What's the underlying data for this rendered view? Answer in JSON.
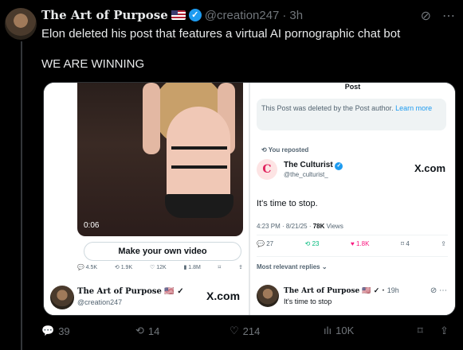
{
  "post": {
    "author_name": "The Art of Purpose",
    "handle": "@creation247",
    "time": "3h",
    "text_line1": "Elon deleted his post that features a virtual AI pornographic chat bot",
    "text_line2": "WE ARE WINNING"
  },
  "media": {
    "video_time": "0:06",
    "make_video_label": "Make your own video",
    "mini_stats": {
      "replies": "4.5K",
      "reposts": "1.9K",
      "likes": "12K",
      "views": "1.8M"
    },
    "mini_author_name": "The Art of Purpose",
    "mini_author_handle": "@creation247",
    "xcom_left": "X.com",
    "right": {
      "header": "Post",
      "deleted_notice": "This Post was deleted by the Post author.",
      "learn_more": "Learn more",
      "reposted": "You reposted",
      "rp_author_name": "The Culturist",
      "rp_author_handle": "@the_culturist_",
      "xcom_right": "X.com",
      "rp_text": "It's time to stop.",
      "rp_time": "4:23 PM · 8/21/25 ·",
      "rp_views": "78K",
      "rp_views_label": "Views",
      "rp_stats": {
        "replies": "27",
        "reposts": "23",
        "likes": "1.8K",
        "bookmarks": "4"
      },
      "most_relevant": "Most relevant replies",
      "reply_name": "The Art of Purpose",
      "reply_time": "19h",
      "reply_text": "It's time to stop"
    }
  },
  "actions": {
    "replies": "39",
    "reposts": "14",
    "likes": "214",
    "views": "10K"
  },
  "colors": {
    "bg": "#000000",
    "text": "#e7e9ea",
    "muted": "#71767b",
    "accent": "#1d9bf0",
    "repost_green": "#00ba7c",
    "like_pink": "#f91880"
  }
}
